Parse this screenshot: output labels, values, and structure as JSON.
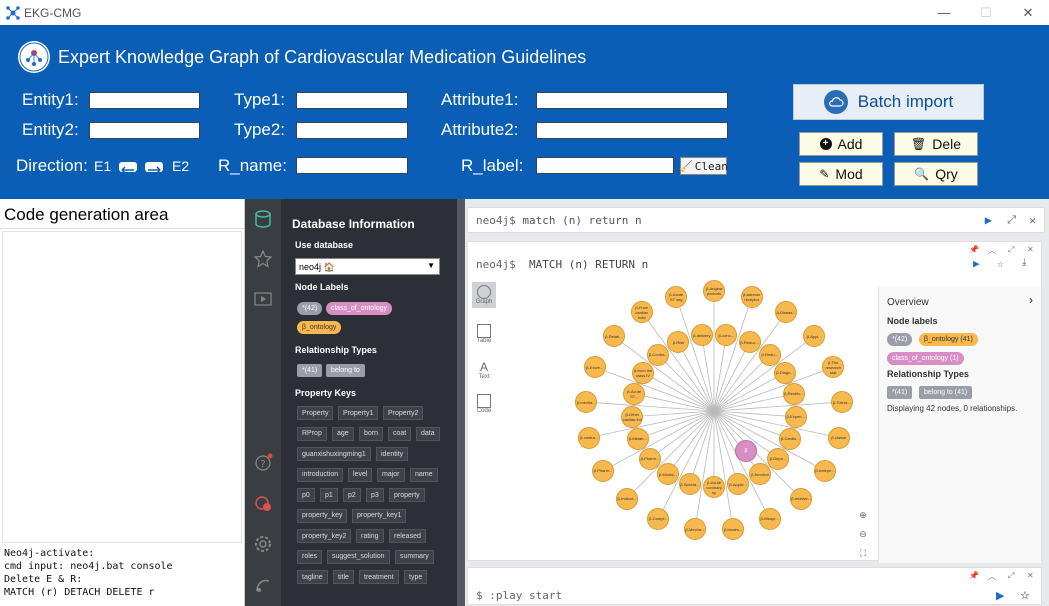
{
  "window": {
    "title": "EKG-CMG",
    "minimize": "—",
    "maximize": "☐",
    "close": "✕"
  },
  "header": {
    "title": "Expert Knowledge Graph of Cardiovascular Medication Guidelines",
    "entity1_label": "Entity1:",
    "entity2_label": "Entity2:",
    "type1_label": "Type1:",
    "type2_label": "Type2:",
    "attribute1_label": "Attribute1:",
    "attribute2_label": "Attribute2:",
    "direction_label": "Direction:",
    "direction_e1": "E1",
    "direction_e2": "E2",
    "rname_label": "R_name:",
    "rlabel_label": "R_label:",
    "clean_label": "Clean",
    "batch_import_label": "Batch import",
    "add_label": "Add",
    "dele_label": "Dele",
    "mod_label": "Mod",
    "qry_label": "Qry"
  },
  "code_area": {
    "title": "Code generation area",
    "log": [
      "Neo4j-activate:",
      "cmd input: neo4j.bat console",
      "Delete E & R:",
      "MATCH (r) DETACH DELETE r"
    ]
  },
  "db_panel": {
    "title": "Database Information",
    "use_database": "Use database",
    "selected_db": "neo4j 🏠",
    "node_labels_title": "Node Labels",
    "node_labels": [
      "*(42)",
      "class_of_ontology",
      "β_ontology"
    ],
    "relationship_types_title": "Relationship Types",
    "relationship_types": [
      "*(41)",
      "belong to"
    ],
    "property_keys_title": "Property Keys",
    "property_keys": [
      "Property",
      "Property1",
      "Property2",
      "RProp",
      "age",
      "born",
      "coat",
      "data",
      "guanxishuxingming1",
      "identity",
      "introduction",
      "level",
      "major",
      "name",
      "p0",
      "p1",
      "p2",
      "p3",
      "property",
      "property_key",
      "property_key1",
      "property_key2",
      "rating",
      "released",
      "roles",
      "suggest_solution",
      "summary",
      "tagline",
      "title",
      "treatment",
      "type"
    ]
  },
  "browser": {
    "prompt": "neo4j$",
    "editor_query": "match (n) return n",
    "frame_query": "MATCH (n) RETURN n",
    "tabs": [
      "Graph",
      "Table",
      "Text",
      "Code"
    ],
    "overview": {
      "title": "Overview",
      "node_labels_title": "Node labels",
      "node_labels": [
        "*(42)",
        "β_ontology (41)",
        "class_of_ontology (1)"
      ],
      "relationship_types_title": "Relationship Types",
      "relationship_types": [
        "*(41)",
        "belong to (41)"
      ],
      "summary": "Displaying 42 nodes, 0 relationships."
    },
    "bottom_prompt": "$",
    "bottom_query": ":play start"
  },
  "graph": {
    "hub_label": "β",
    "node_labels": [
      "β-Angina pectoris",
      "β-conc...",
      "β-adrener receptor",
      "β-Reduc...",
      "β-Diseas...",
      "β-Redu...",
      "β-Appl...",
      "β-Diagn...",
      "β-The research stat",
      "β-Restric...",
      "β-Tolera...",
      "β-Expen...",
      "β-classe",
      "β-Cardio...",
      "β-Indepe...",
      "β-Depri...",
      "β-relative...",
      "β-function",
      "β-Bisopr...",
      "β-Applic...",
      "β-treatm...",
      "β-Acute coronary sy",
      "β-Mecha...",
      "β-Specia...",
      "β-Compl...",
      "β-Modal...",
      "β-Indicat...",
      "β-Pharm...",
      "β-Pharm...",
      "β-Metab...",
      "β-contra...",
      "β-Other cardiac ind",
      "β-mecha...",
      "β-Acute ST...",
      "β-Excre...",
      "β-from the class IV",
      "β-Relati...",
      "β-Contra...",
      "β-From cardiac indic",
      "β-Risk",
      "β-Acute ST seg",
      "β-delivery"
    ],
    "colors": {
      "node_fill": "#f7b94d",
      "hub_fill": "#d78ec4"
    }
  },
  "colors": {
    "header_bg": "#0a5eb5",
    "db_panel_bg": "#2c2f35",
    "pill_pink": "#d78ec4",
    "pill_orange": "#f7b94d",
    "pill_gray": "#9a9ea6"
  }
}
